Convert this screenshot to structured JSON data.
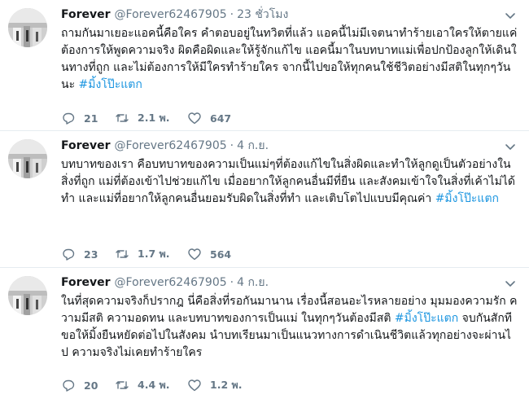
{
  "tweets": [
    {
      "name": "Forever",
      "handle": "@Forever62467905",
      "separator": "·",
      "time": "23 ชั่วโมง",
      "text": "ถามกันมาเยอะแอคนี้คือใคร คำตอบอยู่ในทวิตที่แล้ว แอคนี้ไม่มีเจตนาทำร้ายเอาใครให้ตายแค่ต้องการให้พูดความจริง ผิดคือผิดและให้รู้จักแก้ไข แอคนี้มาในบทบาทแม่เพื่อปกป้องลูกให้เดินในทางที่ถูก และไม่ต้องการให้มีใครทำร้ายใคร จากนี้ไปขอให้ทุกคนใช้ชีวิตอย่างมีสติในทุกๆวันนะ ",
      "hashtag": "#มิ้งโป๊ะแตก",
      "replies": "21",
      "retweets": "2.1 พ.",
      "likes": "647"
    },
    {
      "name": "Forever",
      "handle": "@Forever62467905",
      "separator": "·",
      "time": "4 ก.ย.",
      "text": "บทบาทของเรา คือบทบาทของความเป็นแม่ๆที่ต้องแก้ไขในสิ่งผิดและทำให้ลูกดูเป็นตัวอย่างในสิ่งที่ถูก แม่ที่ต้องเข้าไปช่วยแก้ไข เมื่ออยากให้ลูกคนอื่นมีที่ยืน และสังคมเข้าใจในสิ่งที่เค้าไม่ได้ทำ และแม่ที่อยากให้ลูกคนอื่นยอมรับผิดในสิ่งที่ทำ และเติบโตไปแบบมีคุณค่า ",
      "hashtag": "#มิ้งโป๊ะแตก",
      "replies": "23",
      "retweets": "1.7 พ.",
      "likes": "564"
    },
    {
      "name": "Forever",
      "handle": "@Forever62467905",
      "separator": "·",
      "time": "4 ก.ย.",
      "text": "ในที่สุดความจริงก็ปรากฎ นี่คือสิ่งที่รอกันมานาน เรื่องนี้สอนอะไรหลายอย่าง มุมมองความรัก ความมีสติ ความอดทน และบทบาทของการเป็นแม่ ในทุกๆวันต้องมีสติ ",
      "hashtag": "#มิ้งโป๊ะแตก",
      "text_after": " จบกันสักที ขอให้มิ้งยืนหยัดต่อไปในสังคม นำบทเรียนมาเป็นแนวทางการดำเนินชีวิตแล้วทุกอย่างจะผ่านไป ความจริงไม่เคยทำร้ายใคร",
      "replies": "20",
      "retweets": "4.4 พ.",
      "likes": "1.2 พ."
    }
  ],
  "colors": {
    "text": "#14171a",
    "secondary": "#657786",
    "hashtag": "#1b95e0",
    "divider": "#e6ecf0"
  },
  "icons": {
    "reply": "reply-icon",
    "retweet": "retweet-icon",
    "like": "heart-icon",
    "menu": "chevron-down-icon"
  }
}
